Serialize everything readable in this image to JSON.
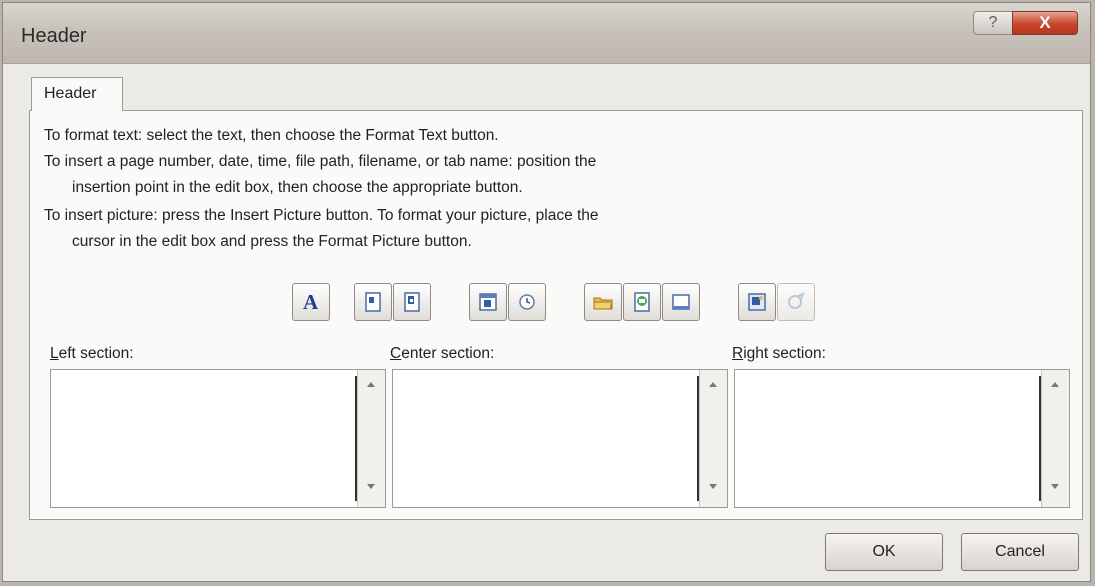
{
  "window": {
    "title": "Header",
    "help_glyph": "?",
    "close_glyph": "X"
  },
  "tabs": [
    {
      "label": "Header"
    }
  ],
  "instructions": {
    "line1": "To format text:  select the text, then choose the Format Text button.",
    "line2": "To insert a page number, date, time, file path, filename, or tab name:  position the",
    "line3": "insertion point in the edit box, then choose the appropriate button.",
    "line4": "To insert picture: press the Insert Picture button.  To format your picture, place the",
    "line5": "cursor in the edit box and press the Format Picture button."
  },
  "toolbar": {
    "format_text_glyph": "A",
    "buttons": [
      {
        "icon": "format-text-icon"
      },
      {
        "icon": "insert-page-number-icon"
      },
      {
        "icon": "insert-number-of-pages-icon"
      },
      {
        "icon": "insert-date-icon"
      },
      {
        "icon": "insert-time-icon"
      },
      {
        "icon": "insert-file-path-icon"
      },
      {
        "icon": "insert-file-name-icon"
      },
      {
        "icon": "insert-sheet-name-icon"
      },
      {
        "icon": "insert-picture-icon"
      },
      {
        "icon": "format-picture-icon"
      }
    ]
  },
  "sections": {
    "left": {
      "mnemonic": "L",
      "rest": "eft section:",
      "value": ""
    },
    "center": {
      "mnemonic": "C",
      "rest": "enter section:",
      "value": ""
    },
    "right": {
      "mnemonic": "R",
      "rest": "ight section:",
      "value": ""
    }
  },
  "buttons": {
    "ok": "OK",
    "cancel": "Cancel"
  },
  "colors": {
    "close_button": "#c8452b",
    "dialog_bg": "#eceae6",
    "panel_bg": "#fbfaf8"
  }
}
